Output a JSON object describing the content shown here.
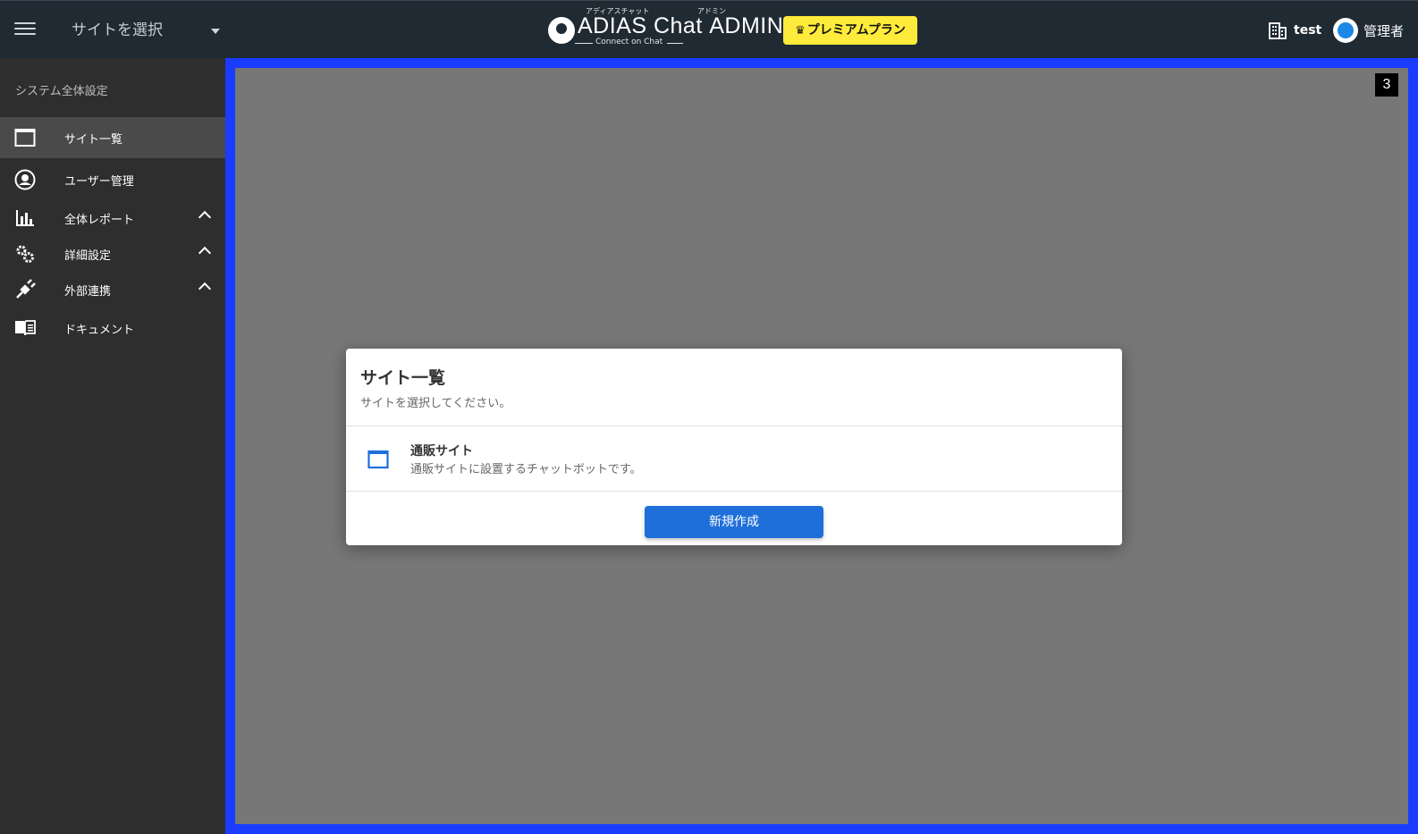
{
  "header": {
    "site_selector": "サイトを選択",
    "logo": {
      "ruby_brand": "アディアスチャット",
      "ruby_admin": "アドミン",
      "brand": "ADIAS Chat",
      "admin": "ADMIN",
      "tagline": "Connect on Chat"
    },
    "premium_label": "プレミアムプラン",
    "org_name": "test",
    "user_role": "管理者"
  },
  "sidebar": {
    "heading": "システム全体設定",
    "items": [
      {
        "label": "サイト一覧",
        "icon": "window-icon",
        "active": true
      },
      {
        "label": "ユーザー管理",
        "icon": "user-icon"
      },
      {
        "label": "全体レポート",
        "icon": "bar-chart-icon",
        "expandable": true
      },
      {
        "label": "詳細設定",
        "icon": "gears-icon",
        "expandable": true
      },
      {
        "label": "外部連携",
        "icon": "plug-icon",
        "expandable": true
      },
      {
        "label": "ドキュメント",
        "icon": "book-icon"
      }
    ]
  },
  "main": {
    "badge": "3"
  },
  "dialog": {
    "title": "サイト一覧",
    "subtitle": "サイトを選択してください。",
    "sites": [
      {
        "name": "通販サイト",
        "description": "通販サイトに設置するチャットボットです。"
      }
    ],
    "create_button": "新規作成"
  },
  "colors": {
    "header_bg": "#1f2a33",
    "sidebar_bg": "#2e2e2e",
    "frame_border": "#1a3cff",
    "premium_yellow": "#ffeb3b",
    "primary_blue": "#1e6fd9"
  }
}
